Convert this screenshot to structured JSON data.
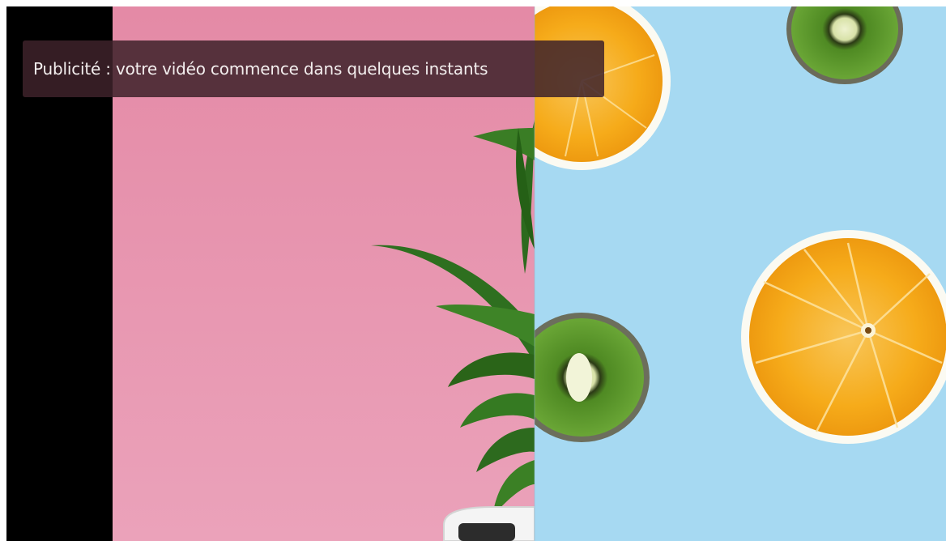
{
  "ad_overlay": {
    "message": "Publicité : votre vidéo commence dans quelques instants"
  },
  "colors": {
    "letterbox": "#000000",
    "pink_backdrop": "#e896b0",
    "blue_backdrop": "#a6d9f2",
    "banner_background": "#3e222a",
    "banner_text": "#f3eeee",
    "orange_flesh": "#f6ad1c",
    "kiwi_flesh": "#5d9a2c",
    "leaf_green": "#2d6a1e"
  },
  "icons": {
    "scene": "split-scene-pink-blue-fruit-image",
    "plant": "plant-leaves-illustration",
    "orange_slice": "orange-slice-illustration",
    "kiwi_slice": "kiwi-slice-illustration",
    "object": "white-object-illustration"
  }
}
